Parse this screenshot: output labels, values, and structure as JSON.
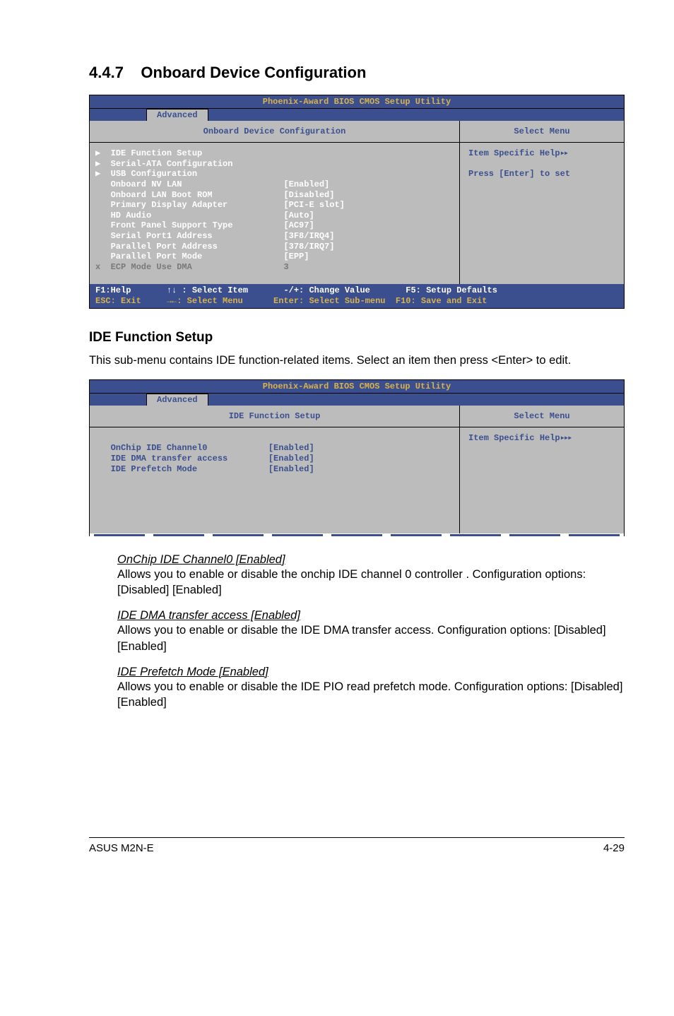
{
  "heading": {
    "num": "4.4.7",
    "title": "Onboard Device Configuration"
  },
  "bios1": {
    "titlebar": "Phoenix-Award BIOS CMOS Setup Utility",
    "tab": "Advanced",
    "header_left": "Onboard Device Configuration",
    "header_right": "Select Menu",
    "body_left": "▶  IDE Function Setup\n▶  Serial-ATA Configuration\n▶  USB Configuration\n   Onboard NV LAN                    [Enabled]\n   Onboard LAN Boot ROM              [Disabled]\n   Primary Display Adapter           [PCI-E slot]\n   HD Audio                          [Auto]\n   Front Panel Support Type          [AC97]\n   Serial Port1 Address              [3F8/IRQ4]\n   Parallel Port Address             [378/IRQ7]\n   Parallel Port Mode                [EPP]",
    "body_left_dim": "x  ECP Mode Use DMA                  3",
    "body_right_line1": "Item Specific Help",
    "body_right_line2": "Press [Enter] to set",
    "foot_l1a": "F1:Help       ↑↓ : Select Item       -/+: Change Value       F5: Setup Defaults",
    "foot_l2a": "ESC: Exit     →←: Select Menu      Enter: Select Sub-menu  F10: Save and Exit"
  },
  "sub1": {
    "title": "IDE Function Setup",
    "para": "This sub-menu contains IDE function-related items. Select an item then press <Enter> to edit."
  },
  "bios2": {
    "titlebar": "Phoenix-Award BIOS CMOS Setup Utility",
    "tab": "Advanced",
    "header_left": "IDE Function Setup",
    "header_right": "Select Menu",
    "body_left": "   OnChip IDE Channel0            [Enabled]\n   IDE DMA transfer access        [Enabled]\n   IDE Prefetch Mode              [Enabled]",
    "body_right_line1": "Item Specific Help"
  },
  "settings": [
    {
      "title": "OnChip IDE Channel0 [Enabled]",
      "desc": "Allows you to enable or disable the onchip IDE channel 0 controller . Configuration options: [Disabled] [Enabled]"
    },
    {
      "title": "IDE DMA transfer access [Enabled]",
      "desc": "Allows you to enable or disable the IDE DMA transfer access. Configuration options: [Disabled] [Enabled]"
    },
    {
      "title": "IDE Prefetch Mode [Enabled]",
      "desc": "Allows you to enable or disable the IDE PIO read prefetch mode. Configuration options: [Disabled] [Enabled]"
    }
  ],
  "footer": {
    "left": "ASUS M2N-E",
    "right": "4-29"
  }
}
